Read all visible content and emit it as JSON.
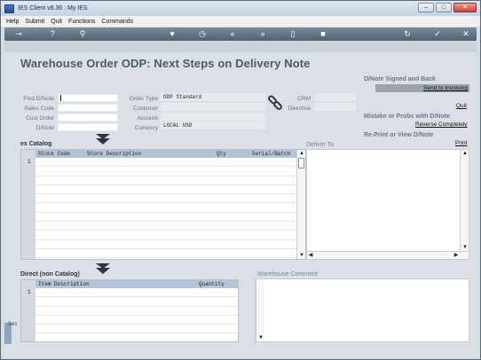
{
  "window": {
    "title": "IES Client v8.36 : My IES",
    "buttons": [
      "–",
      "□",
      "✕"
    ]
  },
  "menu": [
    "Help",
    "Submit",
    "Quit",
    "Functions",
    "Commands"
  ],
  "toolbar": {
    "icons": [
      "key-icon",
      "help-icon",
      "search-icon",
      "heart-icon",
      "clock-icon",
      "rewind-icon",
      "fast-forward-icon",
      "document-icon",
      "square-icon",
      "refresh-icon",
      "checkmark-icon",
      "close-icon"
    ],
    "glyphs": [
      "⊸",
      "?",
      "⚲",
      "♥",
      "◷",
      "«",
      "»",
      "▯",
      "■",
      "↻",
      "✓",
      "✕"
    ]
  },
  "page": {
    "title": "Warehouse Order ODP: Next Steps on Delivery Note"
  },
  "form": {
    "left": [
      {
        "label": "Find D/Note",
        "value": ""
      },
      {
        "label": "Sales Code",
        "value": ""
      },
      {
        "label": "Cust Order",
        "value": ""
      },
      {
        "label": "D/Note",
        "value": ""
      }
    ],
    "middle": [
      {
        "label": "Order Type",
        "value": "ODP Standard"
      },
      {
        "label": "Customer",
        "value": ""
      },
      {
        "label": "Account",
        "value": ""
      },
      {
        "label": "Currency",
        "value": "LOCAL USD"
      }
    ],
    "right": [
      {
        "label": "CRM",
        "value": ""
      },
      {
        "label": "Directive",
        "value": ""
      }
    ]
  },
  "side": {
    "signed_title": "D/Note Signed and Back",
    "send_to_invoicing": "Send to Invoicing",
    "quit": "Quit",
    "mistake_title": "Mistake or Probs with D/Note",
    "reverse_completely": "Reverse Completely",
    "reprint_title": "Re-Print or View D/Note",
    "print": "Print"
  },
  "catalog": {
    "title": "ex Catalog",
    "columns": [
      "Stock Code",
      "Store Description",
      "Qty",
      "Serial/Batch"
    ],
    "first_row_number": "1",
    "deliver_to_label": "Deliver To"
  },
  "noncatalog": {
    "title": "Direct (non Catalog)",
    "columns": [
      "Item Description",
      "Quantity"
    ],
    "first_row_number": "1",
    "warehouse_comment_label": "Warehouse Comment",
    "side_tab": "Ses"
  }
}
